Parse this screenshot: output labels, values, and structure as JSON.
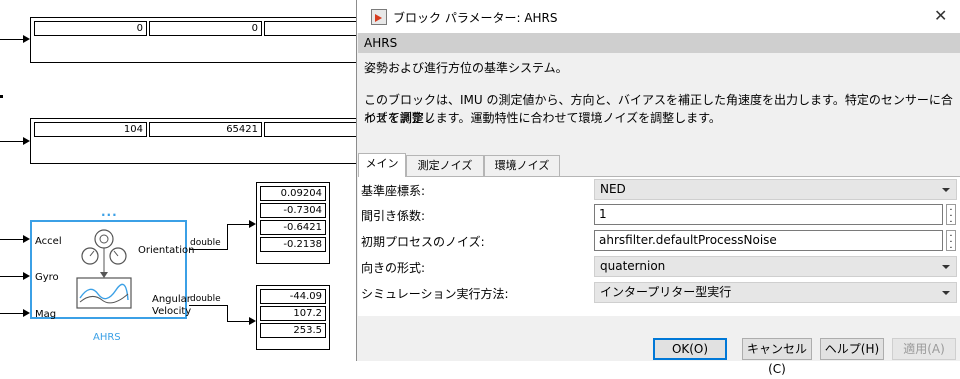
{
  "diagram": {
    "display_top_values": [
      "0",
      "0"
    ],
    "display_mid_values": [
      "104",
      "65421"
    ],
    "orientation_values": [
      "0.09204",
      "-0.7304",
      "-0.6421",
      "-0.2138"
    ],
    "angular_velocity_values": [
      "-44.09",
      "107.2",
      "253.5"
    ],
    "block": {
      "dots": "...",
      "name": "AHRS",
      "inputs": [
        "Accel",
        "Gyro",
        "Mag"
      ],
      "output_orientation": "Orientation",
      "output_angular_line1": "Angular",
      "output_angular_line2": "Velocity"
    },
    "signal_type_1": "double",
    "signal_type_2": "double"
  },
  "dialog": {
    "title": "ブロック パラメーター: AHRS",
    "close_glyph": "✕",
    "section_title": "AHRS",
    "description_1": "姿勢および進行方位の基準システム。",
    "description_2": "このブロックは、IMU の測定値から、方向と、バイアスを補正した角速度を出力します。特定のセンサーに合わせて測定ノ",
    "description_3": "イズを調整します。運動特性に合わせて環境ノイズを調整します。",
    "tabs": [
      "メイン",
      "測定ノイズ",
      "環境ノイズ"
    ],
    "params": {
      "reference_frame_label": "基準座標系:",
      "reference_frame_value": "NED",
      "decimation_label": "間引き係数:",
      "decimation_value": "1",
      "process_noise_label": "初期プロセスのノイズ:",
      "process_noise_value": "ahrsfilter.defaultProcessNoise",
      "orientation_format_label": "向きの形式:",
      "orientation_format_value": "quaternion",
      "sim_mode_label": "シミュレーション実行方法:",
      "sim_mode_value": "インタープリター型実行"
    },
    "buttons": {
      "ok": "OK(O)",
      "cancel": "キャンセル(C)",
      "help": "ヘルプ(H)",
      "apply": "適用(A)"
    }
  }
}
